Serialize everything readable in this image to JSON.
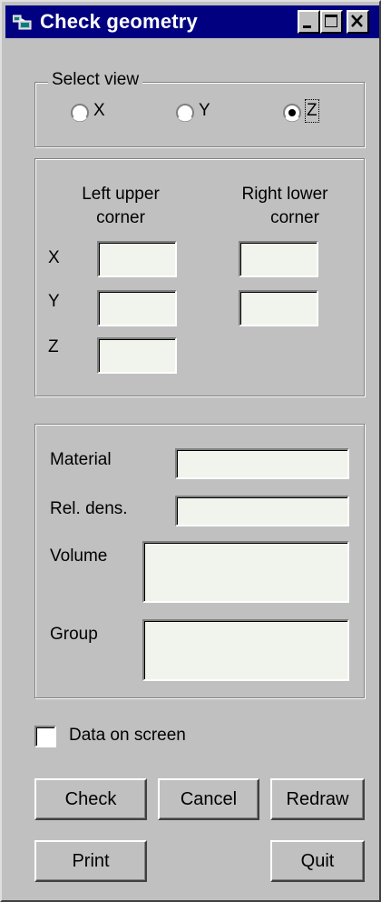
{
  "window": {
    "title": "Check geometry",
    "icons": [
      "app-icon",
      "minimize-icon",
      "maximize-icon",
      "close-icon"
    ]
  },
  "select_view": {
    "legend": "Select view",
    "options": [
      {
        "label": "X",
        "checked": false
      },
      {
        "label": "Y",
        "checked": false
      },
      {
        "label": "Z",
        "checked": true
      }
    ]
  },
  "corners": {
    "left_upper_line1": "Left upper",
    "left_upper_line2": "corner",
    "right_lower_line1": "Right lower",
    "right_lower_line2": "corner",
    "axes": [
      "X",
      "Y",
      "Z"
    ],
    "left_upper_values": {
      "x": "",
      "y": "",
      "z": ""
    },
    "right_lower_values": {
      "x": "",
      "y": ""
    }
  },
  "properties": {
    "material_label": "Material",
    "material_value": "",
    "rel_dens_label": "Rel. dens.",
    "rel_dens_value": "",
    "volume_label": "Volume",
    "volume_value": "",
    "group_label": "Group",
    "group_value": ""
  },
  "data_on_screen": {
    "label": "Data on screen",
    "checked": false
  },
  "buttons": {
    "check": "Check",
    "cancel": "Cancel",
    "redraw": "Redraw",
    "print": "Print",
    "quit": "Quit"
  },
  "colors": {
    "title_bar": "#000080",
    "face": "#c0c0c0",
    "field_bg": "#f0f4ec"
  }
}
